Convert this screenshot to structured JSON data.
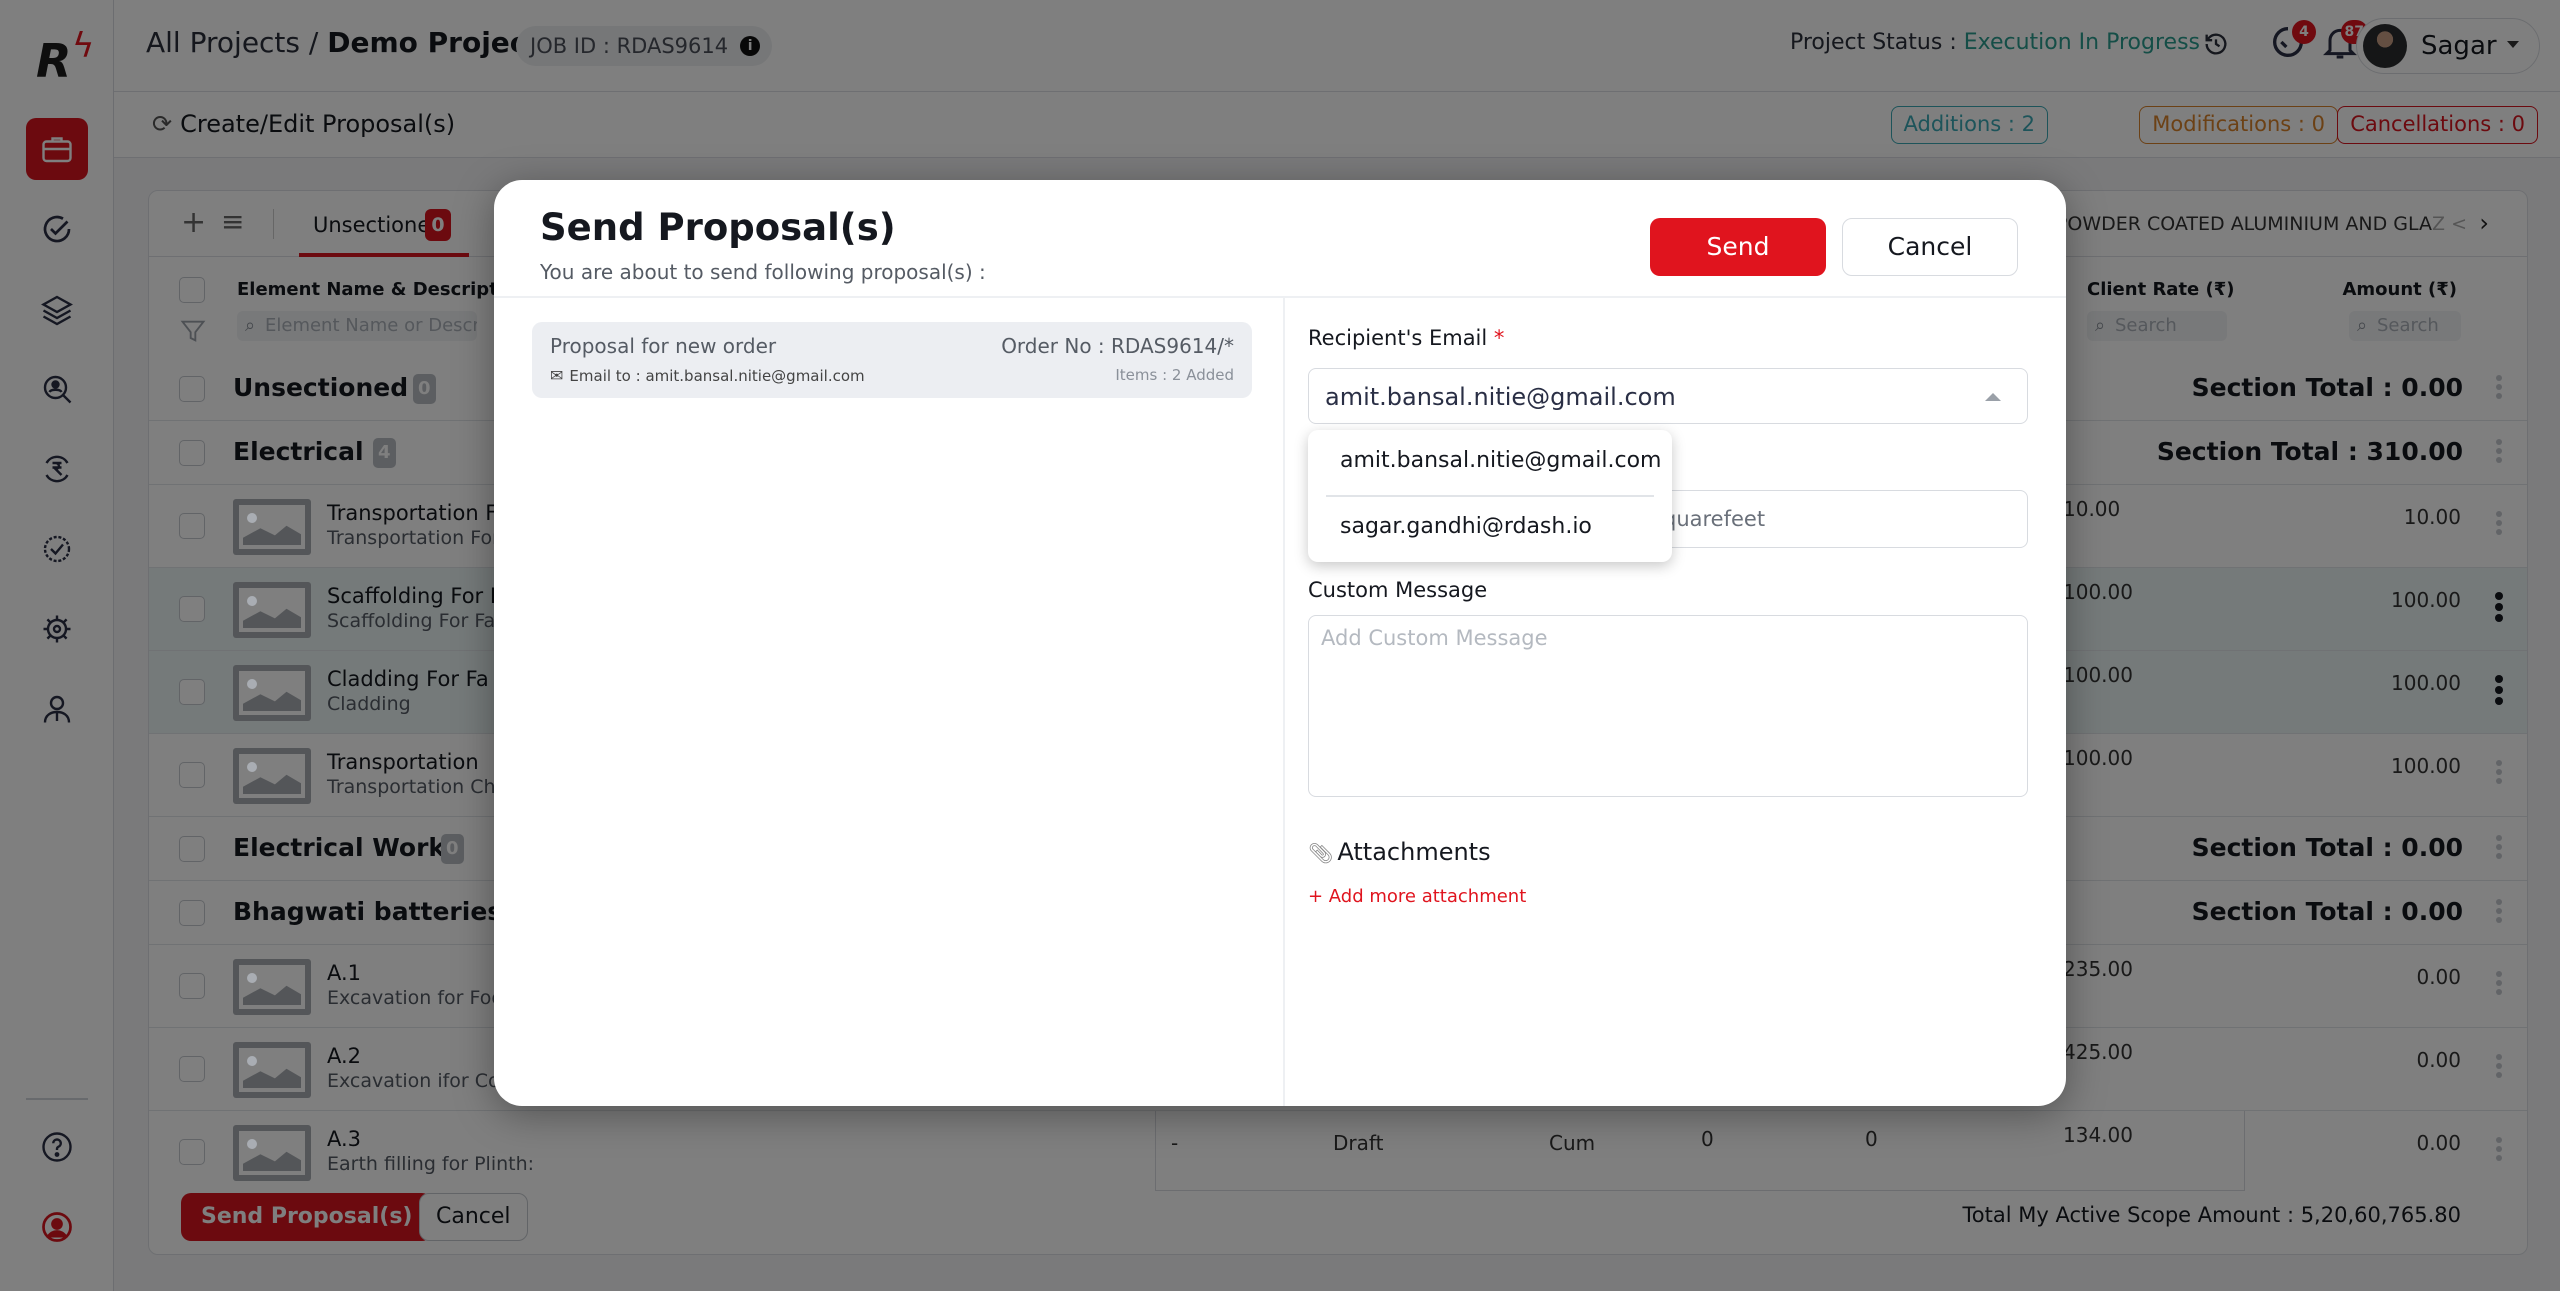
{
  "header": {
    "breadcrumb_root": "All Projects",
    "breadcrumb_separator": "/",
    "project_name": "Demo Project",
    "job_id": "JOB ID : RDAS9614",
    "info_icon": "info-icon",
    "project_status_label": "Project Status :",
    "project_status_value": "Execution In Progress",
    "history_icon": "history-icon",
    "tasks_badge": "4",
    "notifications_badge": "87",
    "user_name": "Sagar"
  },
  "subheader": {
    "title": "Create/Edit Proposal(s)",
    "refresh_icon": "refresh-icon",
    "additions": "Additions : 2",
    "modifications": "Modifications : 0",
    "cancellations": "Cancellations : 0"
  },
  "sidebar": {
    "items": [
      {
        "name": "projects",
        "icon": "briefcase-icon",
        "active": true
      },
      {
        "name": "tasks",
        "icon": "check-circle-icon"
      },
      {
        "name": "layers",
        "icon": "layers-icon"
      },
      {
        "name": "vendor-search",
        "icon": "people-search-icon"
      },
      {
        "name": "payments",
        "icon": "rupee-cycle-icon"
      },
      {
        "name": "approvals",
        "icon": "badge-check-icon"
      },
      {
        "name": "settings",
        "icon": "gear-icon"
      },
      {
        "name": "users",
        "icon": "user-icon"
      }
    ],
    "bottom": [
      {
        "name": "help",
        "icon": "help-icon"
      },
      {
        "name": "support",
        "icon": "support-agent-icon"
      }
    ]
  },
  "table": {
    "tabs": {
      "active_label": "Unsectioned",
      "active_count": "0",
      "right_label": "POWDER COATED ALUMINIUM AND GLA",
      "right_label_fade": "Z <"
    },
    "columns": {
      "element": "Element Name & Description",
      "element_search_placeholder": "Element Name or Descrip",
      "client_rate": "Client Rate (₹)",
      "client_rate_search": "Search",
      "amount": "Amount (₹)",
      "amount_search": "Search"
    },
    "rows": [
      {
        "type": "section",
        "name": "Unsectioned",
        "count": "0",
        "total": "Section Total : 0.00"
      },
      {
        "type": "section",
        "name": "Electrical",
        "count": "4",
        "total": "Section Total : 310.00"
      },
      {
        "type": "item",
        "name": "Transportation F",
        "desc": "Transportation For",
        "client_rate": "10.00",
        "amount": "10.00"
      },
      {
        "type": "item",
        "name": "Scaffolding For F",
        "desc": "Scaffolding For Fac",
        "client_rate": "100.00",
        "amount": "100.00",
        "selected": true
      },
      {
        "type": "item",
        "name": "Cladding For Fa",
        "desc": "Cladding",
        "client_rate": "100.00",
        "amount": "100.00",
        "selected": true
      },
      {
        "type": "item",
        "name": "Transportation",
        "desc": "Transportation Cha",
        "client_rate": "100.00",
        "amount": "100.00"
      },
      {
        "type": "section",
        "name": "Electrical Work",
        "count": "0",
        "total": "Section Total : 0.00"
      },
      {
        "type": "section",
        "name": "Bhagwati batteries",
        "count": "",
        "total": "Section Total : 0.00"
      },
      {
        "type": "item",
        "name": "A.1",
        "desc": "Excavation for Foot",
        "client_rate": "235.00",
        "amount": "0.00"
      },
      {
        "type": "item",
        "name": "A.2",
        "desc": "Excavation ifor Colu",
        "client_rate": "425.00",
        "amount": "0.00"
      },
      {
        "type": "item",
        "name": "A.3",
        "desc": "Earth filling for Plinth:",
        "client_rate": "134.00",
        "amount": "0.00",
        "extra": [
          "-",
          "Draft",
          "Cum",
          "0",
          "0"
        ]
      }
    ],
    "footer": {
      "send_button": "Send Proposal(s)",
      "cancel_button": "Cancel",
      "total": "Total My Active Scope Amount : 5,20,60,765.80"
    }
  },
  "modal": {
    "title": "Send Proposal(s)",
    "subtitle": "You are about to send following proposal(s) :",
    "send_button": "Send",
    "cancel_button": "Cancel",
    "proposal": {
      "name": "Proposal for new order",
      "order_no": "Order No : RDAS9614/*",
      "email_to": "Email to : amit.bansal.nitie@gmail.com",
      "items": "Items : 2 Added"
    },
    "recipient_label": "Recipient's Email",
    "required_mark": "*",
    "recipient_value": "amit.bansal.nitie@gmail.com",
    "recipient_options": [
      "amit.bansal.nitie@gmail.com",
      "sagar.gandhi@rdash.io"
    ],
    "hidden_field_value": "quarefeet",
    "message_label": "Custom Message",
    "message_placeholder": "Add Custom Message",
    "message_value": "",
    "attachments_label": "Attachments",
    "add_attachment": "+ Add more attachment"
  },
  "colors": {
    "brand_red": "#e0141e",
    "status_teal": "#2a9d8f",
    "additions": "#3aa8b5",
    "modifications": "#d9822b",
    "cancellations": "#d9141e"
  }
}
